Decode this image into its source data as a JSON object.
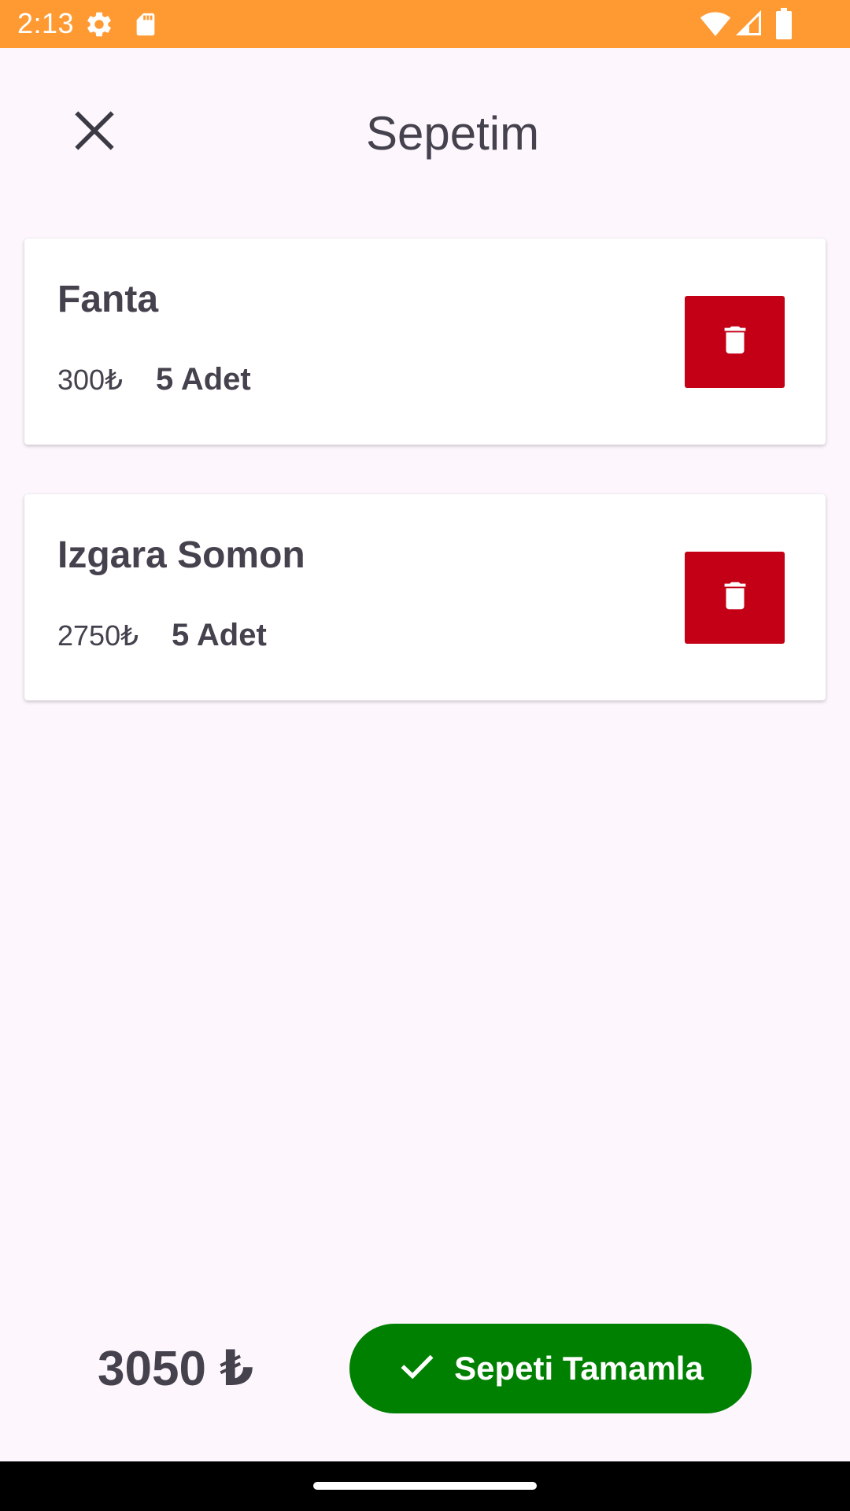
{
  "status_bar": {
    "time": "2:13",
    "background": "#ff9a33",
    "icons_left": [
      "gear-icon",
      "sd-card-icon"
    ],
    "icons_right": [
      "wifi-icon",
      "signal-icon",
      "battery-icon"
    ]
  },
  "header": {
    "title": "Sepetim",
    "close_icon": "close-icon"
  },
  "cart": {
    "items": [
      {
        "name": "Fanta",
        "price": "300₺",
        "quantity": "5 Adet",
        "delete_icon": "trash-icon"
      },
      {
        "name": "Izgara Somon",
        "price": "2750₺",
        "quantity": "5 Adet",
        "delete_icon": "trash-icon"
      }
    ]
  },
  "footer": {
    "total": "3050 ₺",
    "complete_label": "Sepeti Tamamla",
    "complete_icon": "check-icon"
  },
  "colors": {
    "status_bar": "#ff9a33",
    "background": "#fdf6fd",
    "delete_button": "#c30016",
    "complete_button": "#008000",
    "text": "#45424e"
  }
}
